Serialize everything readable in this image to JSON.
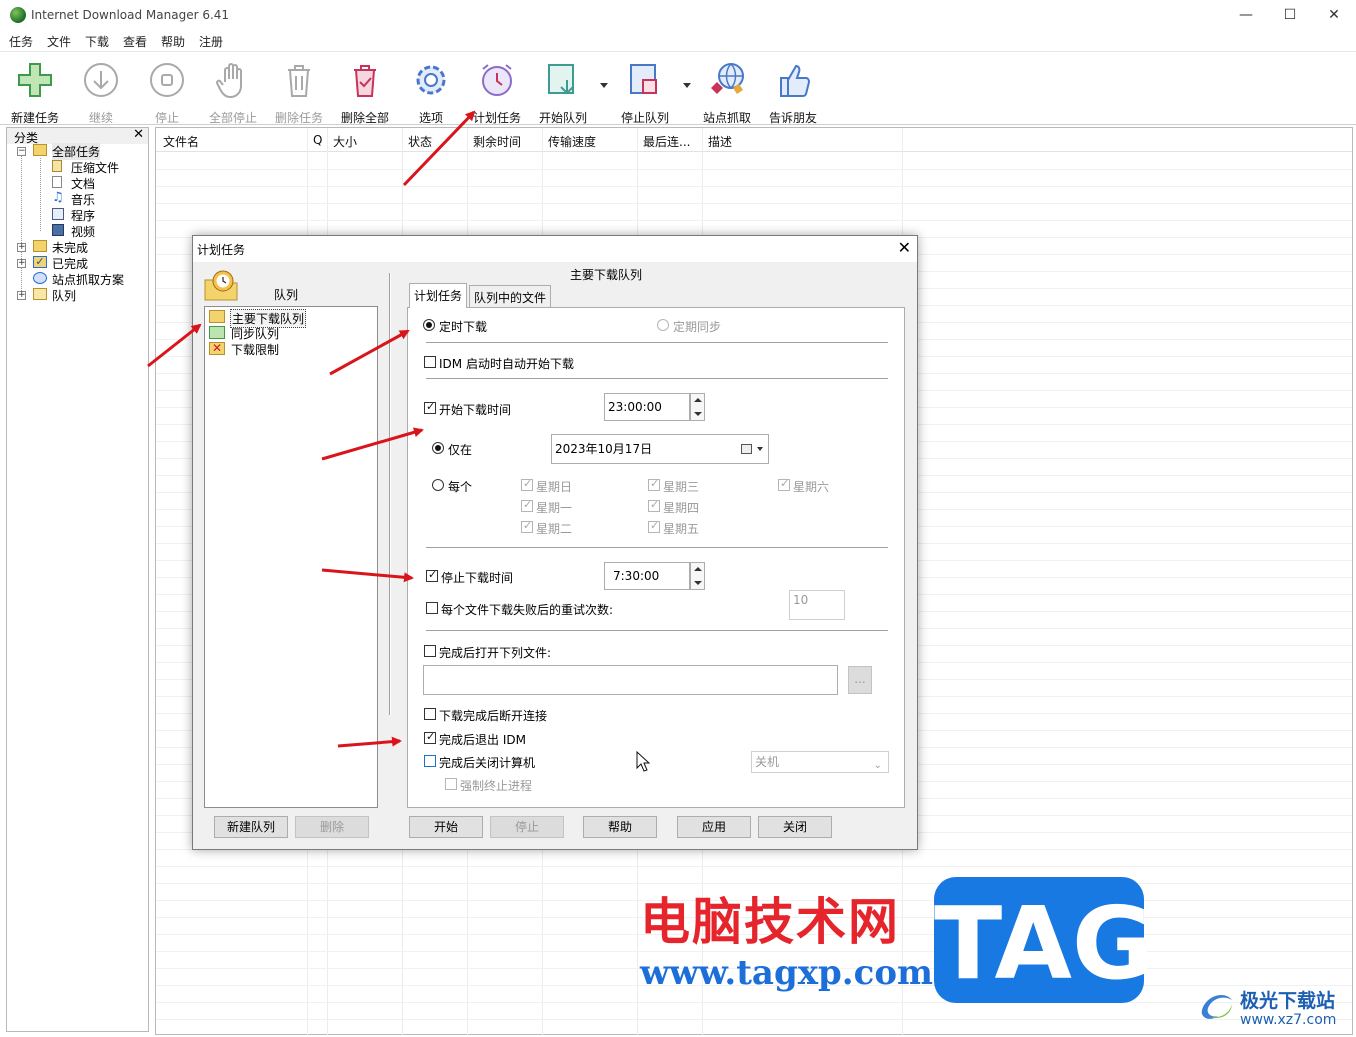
{
  "window": {
    "title": "Internet Download Manager 6.41"
  },
  "menu": [
    "任务",
    "文件",
    "下载",
    "查看",
    "帮助",
    "注册"
  ],
  "toolbar": {
    "new_task": "新建任务",
    "resume": "继续",
    "stop": "停止",
    "stop_all": "全部停止",
    "delete_task": "删除任务",
    "delete_all": "删除全部",
    "options": "选项",
    "scheduler": "计划任务",
    "start_queue": "开始队列",
    "stop_queue": "停止队列",
    "grabber": "站点抓取",
    "tell_friend": "告诉朋友"
  },
  "categories": {
    "header": "分类",
    "all": "全部任务",
    "compressed": "压缩文件",
    "documents": "文档",
    "music": "音乐",
    "programs": "程序",
    "video": "视频",
    "unfinished": "未完成",
    "finished": "已完成",
    "grabber_projects": "站点抓取方案",
    "queues": "队列"
  },
  "columns": [
    "文件名",
    "Q",
    "大小",
    "状态",
    "剩余时间",
    "传输速度",
    "最后连...",
    "描述"
  ],
  "dialog": {
    "title": "计划任务",
    "queue_label": "队列",
    "queues": [
      "主要下载队列",
      "同步队列",
      "下载限制"
    ],
    "new_queue": "新建队列",
    "delete": "删除",
    "selected_queue": "主要下载队列",
    "tabs": [
      "计划任务",
      "队列中的文件"
    ],
    "mode_schedule": "定时下载",
    "mode_sync": "定期同步",
    "start_on_idm_start": "IDM 启动时自动开始下载",
    "start_time_label": "开始下载时间",
    "start_time": "23:00:00",
    "once": "仅在",
    "date": "2023年10月17日",
    "daily": "每个",
    "days": [
      "星期日",
      "星期一",
      "星期二",
      "星期三",
      "星期四",
      "星期五",
      "星期六"
    ],
    "stop_time_label": "停止下载时间",
    "stop_time": "7:30:00",
    "retry_label": "每个文件下载失败后的重试次数:",
    "retry_count": "10",
    "open_file_label": "完成后打开下列文件:",
    "browse": "...",
    "hangup": "下载完成后断开连接",
    "exit_idm": "完成后退出 IDM",
    "shutdown": "完成后关闭计算机",
    "shutdown_mode": "关机",
    "force_kill": "强制终止进程",
    "btn_start": "开始",
    "btn_stop": "停止",
    "btn_help": "帮助",
    "btn_apply": "应用",
    "btn_close": "关闭"
  },
  "watermark": {
    "site_cn": "电脑技术网",
    "site_url": "www.tagxp.com",
    "badge": "TAG",
    "xz_cn": "极光下载站",
    "xz_url": "www.xz7.com"
  },
  "colors": {
    "annotation_arrow": "#d9141a",
    "badge": "#1979e3",
    "watermark_red": "#e6242b"
  }
}
